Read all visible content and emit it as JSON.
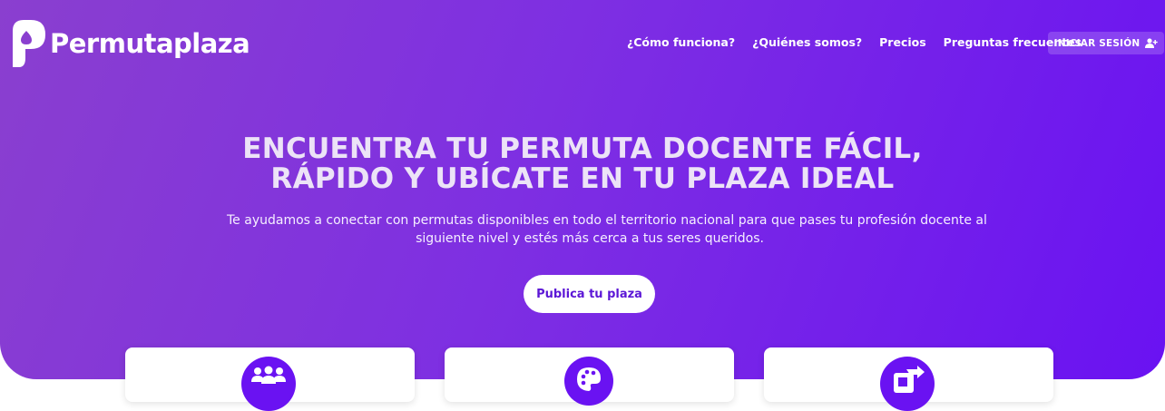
{
  "brand": {
    "name": "Permutaplaza",
    "logo_icon": "p-drop-logo-icon"
  },
  "nav": {
    "items": [
      {
        "label": "¿Cómo funciona?"
      },
      {
        "label": "¿Quiénes somos?"
      },
      {
        "label": "Precios"
      },
      {
        "label": "Preguntas frecuentes"
      }
    ],
    "login_label": "INICIAR SESIÓN",
    "login_icon": "user-plus-icon"
  },
  "hero": {
    "headline_line1": "ENCUENTRA TU PERMUTA DOCENTE FÁCIL,",
    "headline_line2": "RÁPIDO Y UBÍCATE EN TU PLAZA IDEAL",
    "subtitle_line1": "Te ayudamos a conectar con permutas disponibles en todo el territorio nacional para que pases tu profesión docente al",
    "subtitle_line2": "siguiente nivel y estés más cerca a tus seres queridos.",
    "cta_label": "Publica tu plaza"
  },
  "features": [
    {
      "icon": "users-group-icon"
    },
    {
      "icon": "palette-icon"
    },
    {
      "icon": "share-document-icon"
    }
  ],
  "colors": {
    "gradient_start": "#8a3fcf",
    "gradient_end": "#6a12f2",
    "accent": "#6a12f2",
    "cta_text": "#5c17d6"
  }
}
